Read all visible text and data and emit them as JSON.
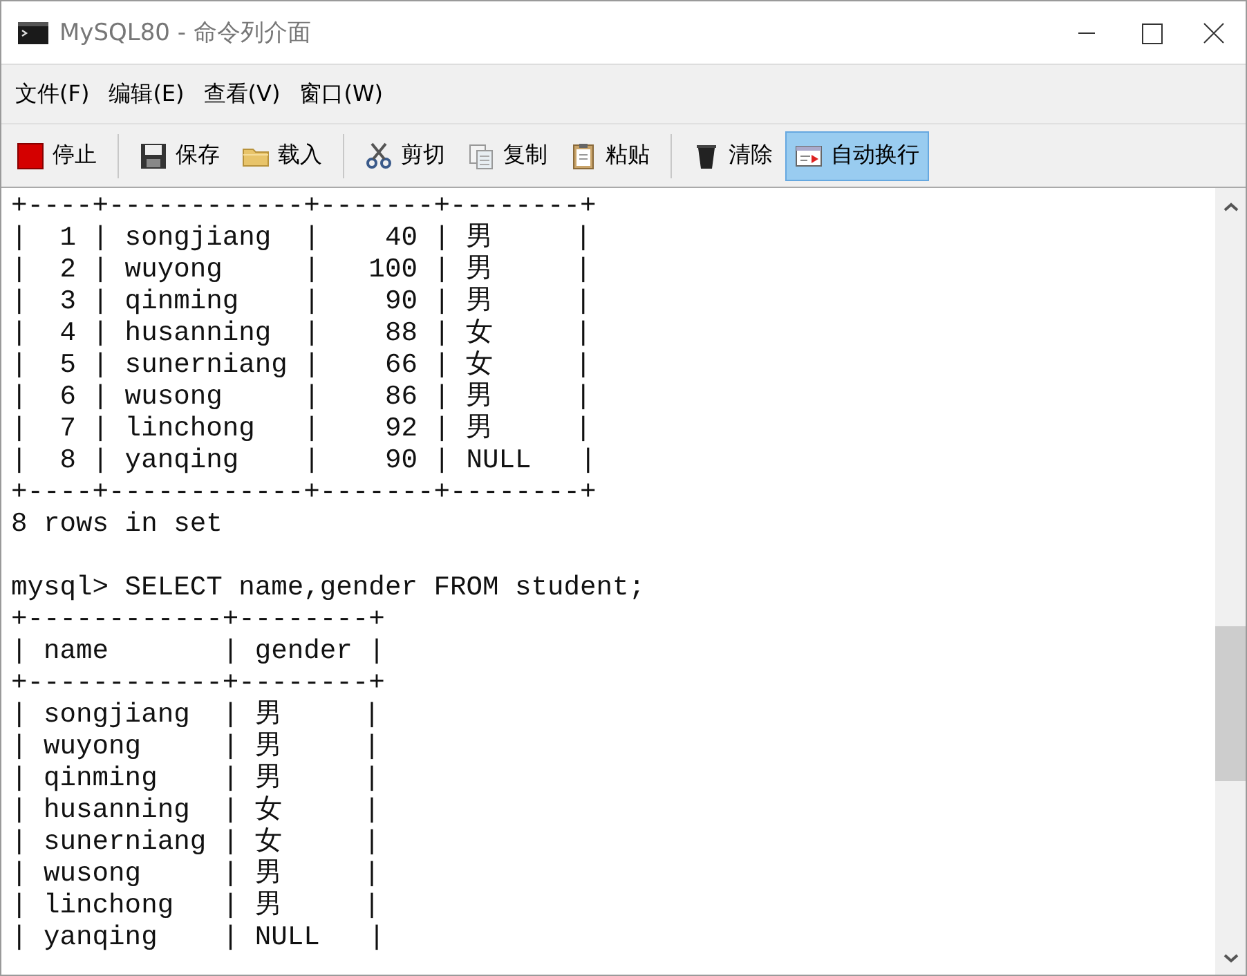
{
  "window": {
    "title": "MySQL80 - 命令列介面"
  },
  "menu": [
    {
      "label": "文件(F)"
    },
    {
      "label": "编辑(E)"
    },
    {
      "label": "查看(V)"
    },
    {
      "label": "窗口(W)"
    }
  ],
  "toolbar": {
    "groups": [
      [
        {
          "label": "停止",
          "on": false
        }
      ],
      [
        {
          "label": "保存",
          "on": false
        },
        {
          "label": "载入",
          "on": false
        }
      ],
      [
        {
          "label": "剪切",
          "on": false
        },
        {
          "label": "复制",
          "on": false
        },
        {
          "label": "粘贴",
          "on": false
        }
      ],
      [
        {
          "label": "清除",
          "on": false
        },
        {
          "label": "自动换行",
          "on": true
        }
      ]
    ]
  },
  "console": {
    "blocks": [
      [
        "+----+------------+-------+--------+",
        "|  1 | songjiang  |    40 | 男     |",
        "|  2 | wuyong     |   100 | 男     |",
        "|  3 | qinming    |    90 | 男     |",
        "|  4 | husanning  |    88 | 女     |",
        "|  5 | sunerniang |    66 | 女     |",
        "|  6 | wusong     |    86 | 男     |",
        "|  7 | linchong   |    92 | 男     |",
        "|  8 | yanqing    |    90 | NULL   |",
        "+----+------------+-------+--------+",
        "8 rows in set"
      ],
      [
        "mysql> SELECT name,gender FROM student;",
        "+------------+--------+",
        "| name       | gender |",
        "+------------+--------+",
        "| songjiang  | 男     |",
        "| wuyong     | 男     |",
        "| qinming    | 男     |",
        "| husanning  | 女     |",
        "| sunerniang | 女     |",
        "| wusong     | 男     |",
        "| linchong   | 男     |",
        "| yanqing    | NULL   |"
      ]
    ]
  }
}
